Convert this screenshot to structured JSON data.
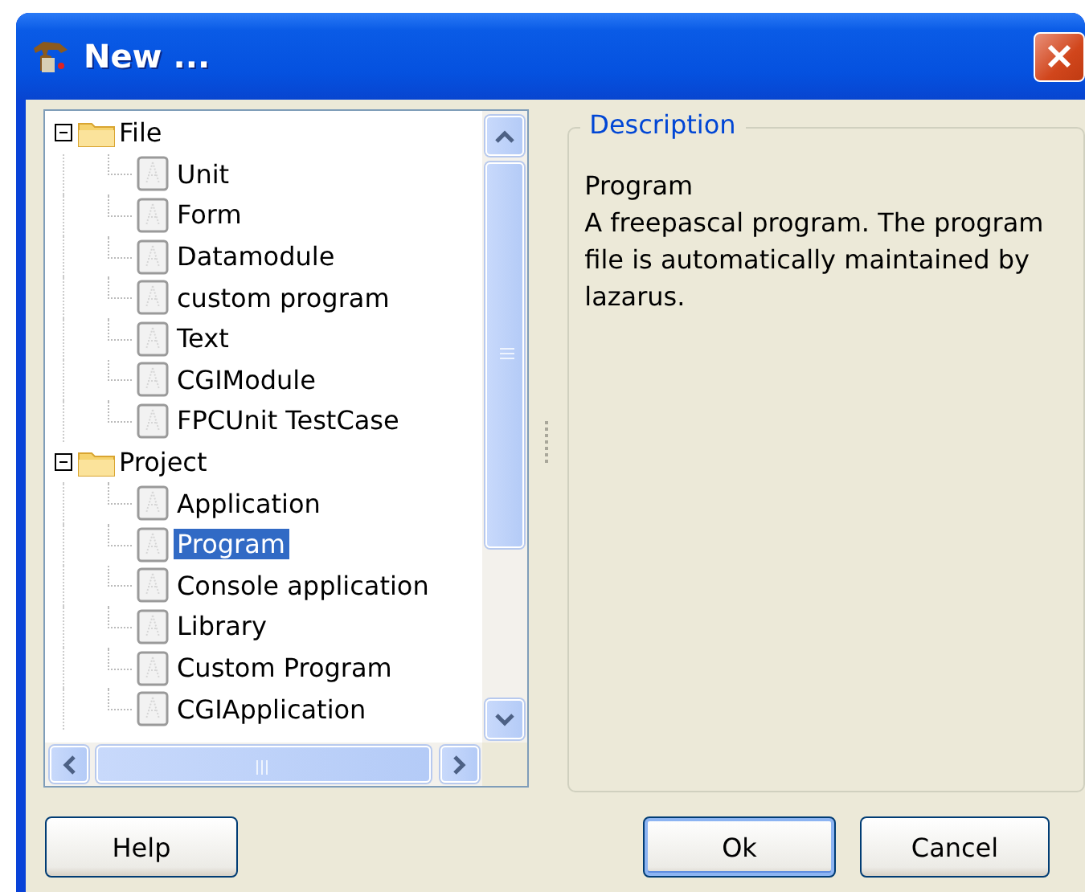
{
  "window": {
    "title": "New ..."
  },
  "tree": {
    "items": [
      {
        "label": "File",
        "kind": "folder",
        "expanded": true,
        "selected": false,
        "children": [
          {
            "label": "Unit",
            "kind": "file",
            "selected": false
          },
          {
            "label": "Form",
            "kind": "file",
            "selected": false
          },
          {
            "label": "Datamodule",
            "kind": "file",
            "selected": false
          },
          {
            "label": "custom program",
            "kind": "file",
            "selected": false
          },
          {
            "label": "Text",
            "kind": "file",
            "selected": false
          },
          {
            "label": "CGIModule",
            "kind": "file",
            "selected": false
          },
          {
            "label": "FPCUnit TestCase",
            "kind": "file",
            "selected": false
          }
        ]
      },
      {
        "label": "Project",
        "kind": "folder",
        "expanded": true,
        "selected": false,
        "children": [
          {
            "label": "Application",
            "kind": "file",
            "selected": false
          },
          {
            "label": "Program",
            "kind": "file",
            "selected": true
          },
          {
            "label": "Console application",
            "kind": "file",
            "selected": false
          },
          {
            "label": "Library",
            "kind": "file",
            "selected": false
          },
          {
            "label": "Custom Program",
            "kind": "file",
            "selected": false
          },
          {
            "label": "CGIApplication",
            "kind": "file",
            "selected": false
          }
        ]
      }
    ]
  },
  "description": {
    "title": "Description",
    "heading": "Program",
    "text": "A freepascal program. The program file is automatically maintained by lazarus."
  },
  "buttons": [
    {
      "label": "Help",
      "default": false
    },
    {
      "label": "Ok",
      "default": true
    },
    {
      "label": "Cancel",
      "default": false
    }
  ]
}
